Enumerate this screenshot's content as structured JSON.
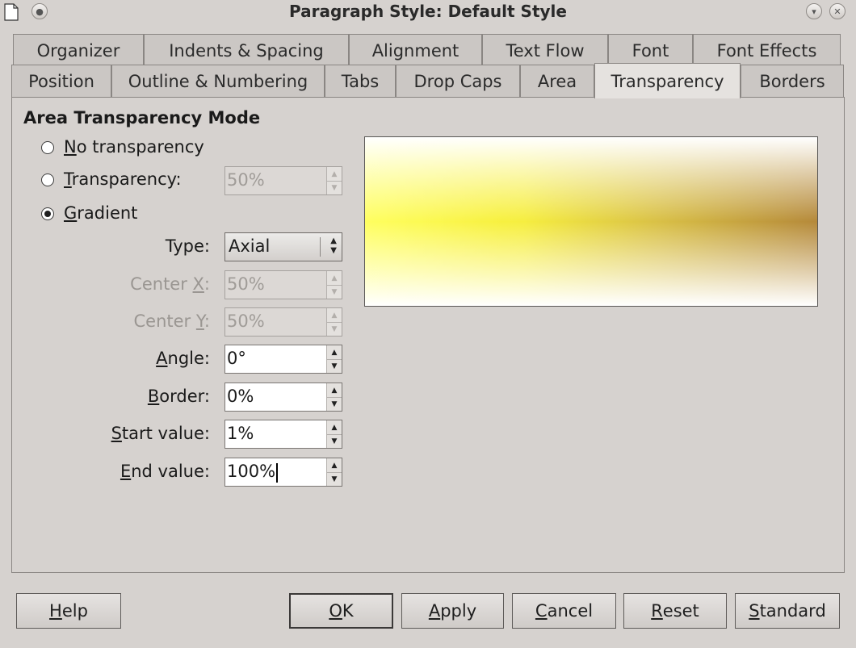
{
  "window": {
    "title": "Paragraph Style: Default Style"
  },
  "tabs_row1": [
    "Organizer",
    "Indents & Spacing",
    "Alignment",
    "Text Flow",
    "Font",
    "Font Effects"
  ],
  "tabs_row2": [
    "Position",
    "Outline & Numbering",
    "Tabs",
    "Drop Caps",
    "Area",
    "Transparency",
    "Borders"
  ],
  "active_tab": "Transparency",
  "section": {
    "title": "Area Transparency Mode"
  },
  "mode": {
    "no_transparency": {
      "mn": "N",
      "rest": "o transparency",
      "selected": false
    },
    "transparency": {
      "mn": "T",
      "rest": "ransparency:",
      "selected": false,
      "value": "50%"
    },
    "gradient": {
      "mn": "G",
      "rest": "radient",
      "selected": true
    }
  },
  "fields": {
    "type": {
      "pre": "",
      "mn": "",
      "post": "Type:",
      "value": "Axial"
    },
    "center_x": {
      "pre": "Center ",
      "mn": "X",
      "post": ":",
      "value": "50%"
    },
    "center_y": {
      "pre": "Center ",
      "mn": "Y",
      "post": ":",
      "value": "50%"
    },
    "angle": {
      "pre": "",
      "mn": "A",
      "post": "ngle:",
      "value": "0°"
    },
    "border": {
      "pre": "",
      "mn": "B",
      "post": "order:",
      "value": "0%"
    },
    "start_value": {
      "pre": "",
      "mn": "S",
      "post": "tart value:",
      "value": "1%"
    },
    "end_value": {
      "pre": "",
      "mn": "E",
      "post": "nd value:",
      "value": "100%"
    }
  },
  "buttons": {
    "help": {
      "mn": "H",
      "rest": "elp"
    },
    "ok": {
      "mn": "O",
      "rest": "K"
    },
    "apply": {
      "mn": "A",
      "rest": "pply"
    },
    "cancel": {
      "mn": "C",
      "rest": "ancel"
    },
    "reset": {
      "mn": "R",
      "rest": "eset"
    },
    "standard": {
      "mn": "S",
      "rest": "tandard"
    }
  },
  "colors": {
    "preview_yellow": "#ffff33",
    "preview_brown": "#b58a3c"
  }
}
